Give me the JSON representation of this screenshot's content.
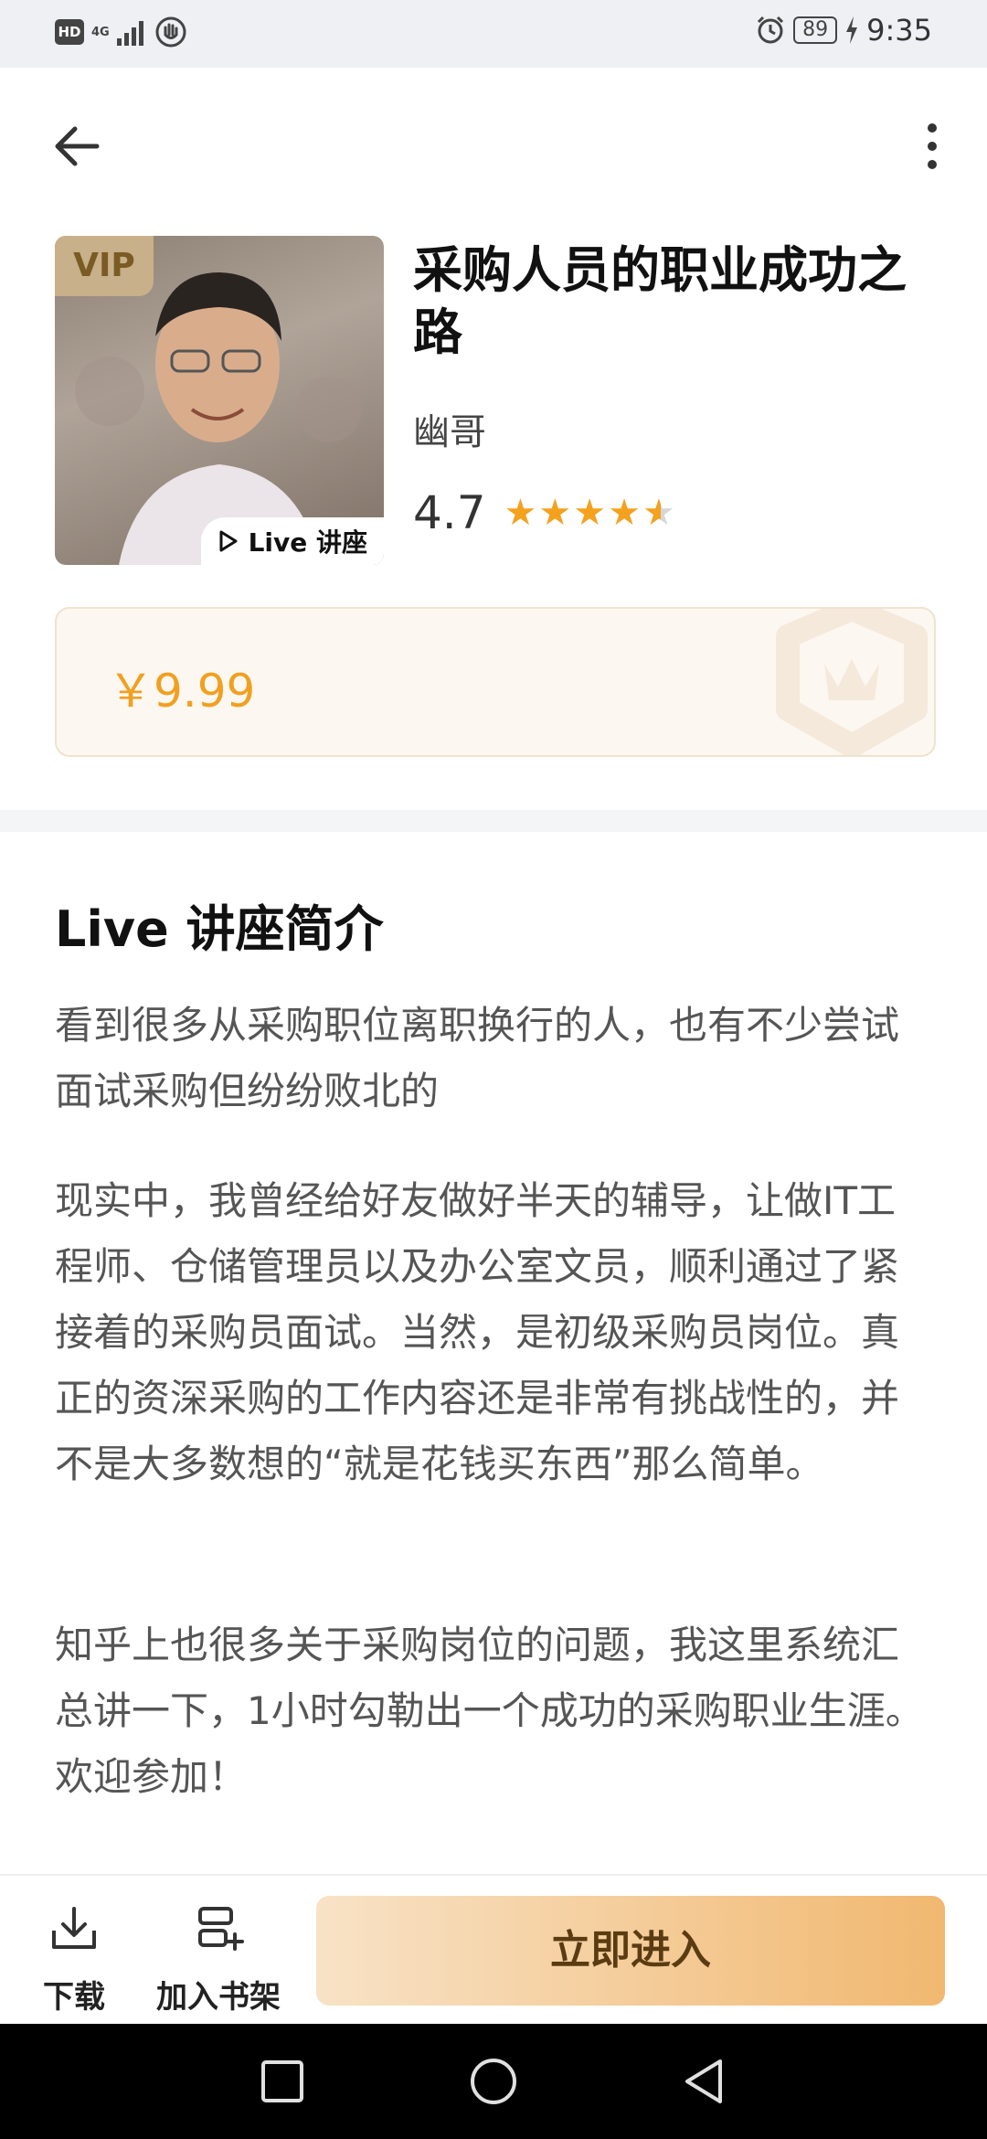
{
  "status_bar": {
    "left_badge": "HD",
    "network": "4G",
    "battery": "89",
    "time": "9:35"
  },
  "course": {
    "vip": "VIP",
    "live_badge": "Live 讲座",
    "title": "采购人员的职业成功之路",
    "author": "幽哥",
    "rating": "4.7",
    "stars": 4.5,
    "price": "￥9.99"
  },
  "intro": {
    "heading": "Live 讲座简介",
    "paragraphs": [
      "看到很多从采购职位离职换行的人，也有不少尝试面试采购但纷纷败北的",
      "现实中，我曾经给好友做好半天的辅导，让做IT工程师、仓储管理员以及办公室文员，顺利通过了紧接着的采购员面试。当然，是初级采购员岗位。真正的资深采购的工作内容还是非常有挑战性的，并不是大多数想的“就是花钱买东西”那么简单。",
      "知乎上也很多关于采购岗位的问题，我这里系统汇总讲一下，1小时勾勒出一个成功的采购职业生涯。欢迎参加！"
    ]
  },
  "actions": {
    "download": "下载",
    "add_to_shelf": "加入书架",
    "enter": "立即进入"
  },
  "colors": {
    "accent": "#f0a020",
    "star": "#f4a11e"
  }
}
